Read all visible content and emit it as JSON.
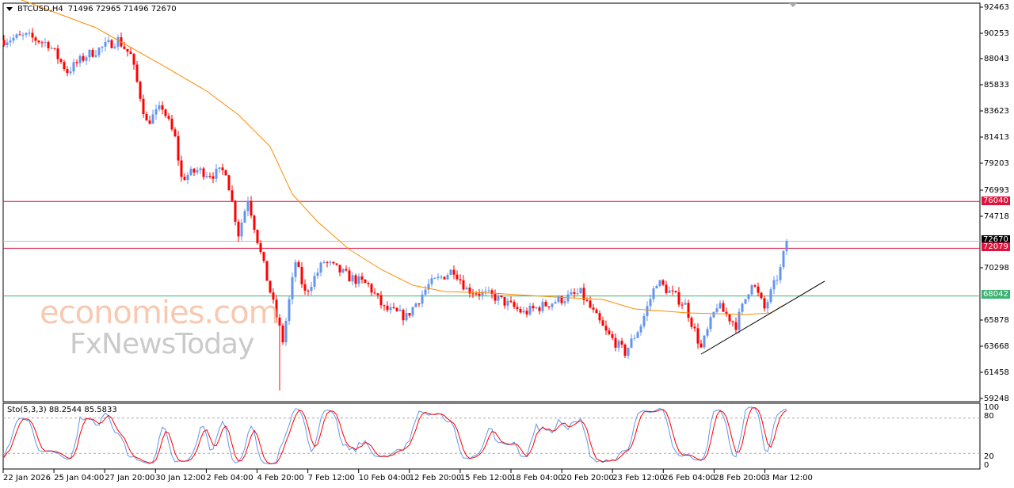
{
  "header": {
    "symbol": "BTCUSD,H4",
    "ohlc": "71496 72965 71496 72670"
  },
  "stochastic": {
    "label": "Sto(5,3,3) 88.2544 85.5833",
    "levels": [
      "100",
      "80",
      "20",
      "0"
    ]
  },
  "watermark": {
    "line1": "economies.com",
    "line2": "FxNewsToday"
  },
  "price_axis": [
    "92463",
    "90253",
    "88043",
    "85833",
    "83623",
    "81413",
    "79203",
    "76993",
    "74718",
    "70298",
    "65878",
    "63668",
    "61458",
    "59248"
  ],
  "price_tags": {
    "current": {
      "value": "72670",
      "color": "#000000"
    },
    "r1": {
      "value": "76040",
      "color": "#dc143c"
    },
    "r2": {
      "value": "72079",
      "color": "#dc143c"
    },
    "s1": {
      "value": "68042",
      "color": "#3cb371"
    }
  },
  "time_axis": [
    "22 Jan 2026",
    "25 Jan 04:00",
    "27 Jan 20:00",
    "30 Jan 12:00",
    "2 Feb 04:00",
    "4 Feb 20:00",
    "7 Feb 12:00",
    "10 Feb 04:00",
    "12 Feb 20:00",
    "15 Feb 12:00",
    "18 Feb 04:00",
    "20 Feb 20:00",
    "23 Feb 12:00",
    "26 Feb 04:00",
    "28 Feb 20:00",
    "3 Mar 12:00"
  ],
  "chart_data": {
    "type": "candlestick",
    "symbol": "BTCUSD",
    "timeframe": "H4",
    "ylim": [
      59248,
      92463
    ],
    "up_color": "#6495ed",
    "down_color": "#ff0000",
    "close_waypoints": [
      [
        0,
        89700
      ],
      [
        7,
        90000
      ],
      [
        14,
        89380
      ],
      [
        20,
        87040
      ],
      [
        26,
        88380
      ],
      [
        36,
        89700
      ],
      [
        40,
        88380
      ],
      [
        45,
        82686
      ],
      [
        50,
        84025
      ],
      [
        54,
        81346
      ],
      [
        56,
        77997
      ],
      [
        61,
        78667
      ],
      [
        66,
        78332
      ],
      [
        70,
        78667
      ],
      [
        74,
        73310
      ],
      [
        77,
        76323
      ],
      [
        81,
        71635
      ],
      [
        86,
        66278
      ],
      [
        88,
        64269
      ],
      [
        92,
        70966
      ],
      [
        95,
        68287
      ],
      [
        101,
        70966
      ],
      [
        109,
        69627
      ],
      [
        115,
        68957
      ],
      [
        120,
        66948
      ],
      [
        127,
        66278
      ],
      [
        134,
        68957
      ],
      [
        142,
        70296
      ],
      [
        146,
        68622
      ],
      [
        155,
        67952
      ],
      [
        164,
        66613
      ],
      [
        174,
        67617
      ],
      [
        182,
        68287
      ],
      [
        190,
        64938
      ],
      [
        196,
        63263
      ],
      [
        201,
        65608
      ],
      [
        206,
        69292
      ],
      [
        215,
        67282
      ],
      [
        220,
        63598
      ],
      [
        225,
        67282
      ],
      [
        231,
        65608
      ],
      [
        236,
        69292
      ],
      [
        240,
        66948
      ],
      [
        245,
        70296
      ],
      [
        247,
        72670
      ]
    ],
    "wick_extremes": [
      {
        "i": 87,
        "low": 60050
      }
    ],
    "moving_average": {
      "color": "#ff8c00",
      "points": [
        [
          9,
          92731
        ],
        [
          29,
          90722
        ],
        [
          49,
          87708
        ],
        [
          64,
          85364
        ],
        [
          74,
          83355
        ],
        [
          84,
          80676
        ],
        [
          91,
          76658
        ],
        [
          99,
          74314
        ],
        [
          109,
          71970
        ],
        [
          119,
          70296
        ],
        [
          129,
          68957
        ],
        [
          139,
          68421
        ],
        [
          154,
          68287
        ],
        [
          174,
          67952
        ],
        [
          189,
          67751
        ],
        [
          199,
          66948
        ],
        [
          216,
          66613
        ],
        [
          234,
          66479
        ],
        [
          242,
          66613
        ],
        [
          246,
          67282
        ]
      ]
    },
    "trendline": {
      "from": [
        220,
        63130
      ],
      "to": [
        259,
        69292
      ],
      "color": "#000000"
    },
    "horizontal_levels": [
      {
        "price": 76040,
        "color": "#dc143c"
      },
      {
        "price": 72079,
        "color": "#dc143c"
      },
      {
        "price": 68042,
        "color": "#3cb371"
      },
      {
        "price": 72670,
        "color": "#c0c0c0"
      }
    ],
    "stochastic": {
      "k": 5,
      "d": 3,
      "slowing": 3,
      "k_value": 88.2544,
      "d_value": 85.5833,
      "k_color": "#6495ed",
      "d_color": "#ff0000",
      "levels": [
        80,
        20
      ]
    }
  }
}
